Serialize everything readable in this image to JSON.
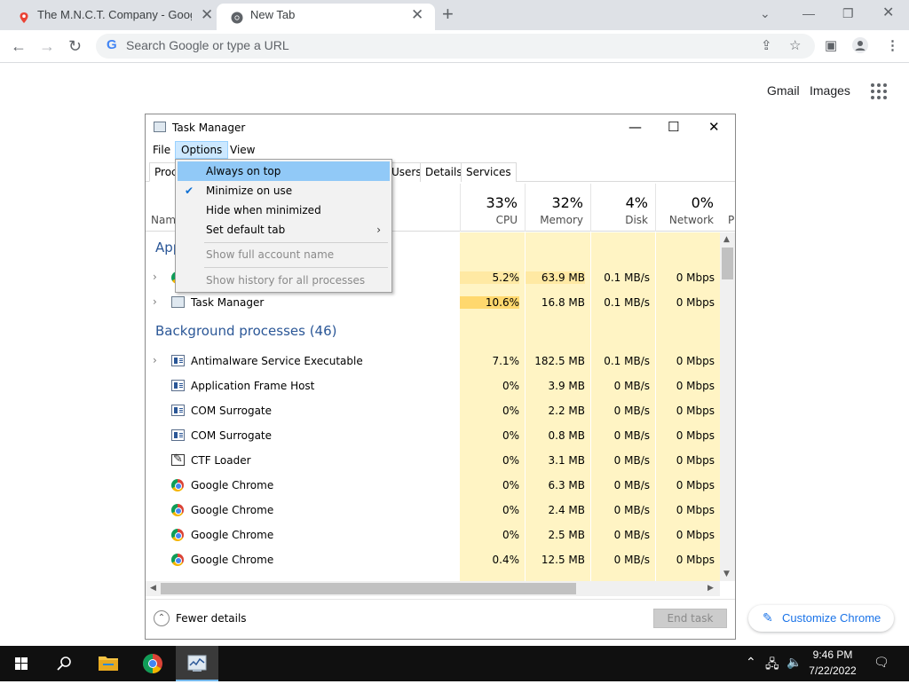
{
  "browser": {
    "tabs": [
      {
        "title": "The M.N.C.T. Company - Google"
      },
      {
        "title": "New Tab"
      }
    ],
    "address_placeholder": "Search Google or type a URL"
  },
  "ntp": {
    "gmail": "Gmail",
    "images": "Images",
    "customize": "Customize Chrome"
  },
  "task_manager": {
    "title": "Task Manager",
    "menu": [
      "File",
      "Options",
      "View"
    ],
    "tabs": [
      "Proc",
      "Users",
      "Details",
      "Services"
    ],
    "columns": [
      {
        "pct": "33%",
        "label": "CPU"
      },
      {
        "pct": "32%",
        "label": "Memory"
      },
      {
        "pct": "4%",
        "label": "Disk"
      },
      {
        "pct": "0%",
        "label": "Network"
      }
    ],
    "name_col": "Nam",
    "power_col": "P",
    "apps_group": "App",
    "bg_group": "Background processes (46)",
    "rows": [
      {
        "name": "",
        "cpu": "5.2%",
        "mem": "63.9 MB",
        "disk": "0.1 MB/s",
        "net": "0 Mbps"
      },
      {
        "name": "Task Manager",
        "cpu": "10.6%",
        "mem": "16.8 MB",
        "disk": "0.1 MB/s",
        "net": "0 Mbps"
      },
      {
        "name": "Antimalware Service Executable",
        "cpu": "7.1%",
        "mem": "182.5 MB",
        "disk": "0.1 MB/s",
        "net": "0 Mbps"
      },
      {
        "name": "Application Frame Host",
        "cpu": "0%",
        "mem": "3.9 MB",
        "disk": "0 MB/s",
        "net": "0 Mbps"
      },
      {
        "name": "COM Surrogate",
        "cpu": "0%",
        "mem": "2.2 MB",
        "disk": "0 MB/s",
        "net": "0 Mbps"
      },
      {
        "name": "COM Surrogate",
        "cpu": "0%",
        "mem": "0.8 MB",
        "disk": "0 MB/s",
        "net": "0 Mbps"
      },
      {
        "name": "CTF Loader",
        "cpu": "0%",
        "mem": "3.1 MB",
        "disk": "0 MB/s",
        "net": "0 Mbps"
      },
      {
        "name": "Google Chrome",
        "cpu": "0%",
        "mem": "6.3 MB",
        "disk": "0 MB/s",
        "net": "0 Mbps"
      },
      {
        "name": "Google Chrome",
        "cpu": "0%",
        "mem": "2.4 MB",
        "disk": "0 MB/s",
        "net": "0 Mbps"
      },
      {
        "name": "Google Chrome",
        "cpu": "0%",
        "mem": "2.5 MB",
        "disk": "0 MB/s",
        "net": "0 Mbps"
      },
      {
        "name": "Google Chrome",
        "cpu": "0.4%",
        "mem": "12.5 MB",
        "disk": "0 MB/s",
        "net": "0 Mbps"
      }
    ],
    "fewer_details": "Fewer details",
    "end_task": "End task"
  },
  "options_menu": {
    "items": [
      {
        "label": "Always on top",
        "checked": false,
        "enabled": true
      },
      {
        "label": "Minimize on use",
        "checked": true,
        "enabled": true
      },
      {
        "label": "Hide when minimized",
        "checked": false,
        "enabled": true
      },
      {
        "label": "Set default tab",
        "submenu": true,
        "enabled": true
      },
      {
        "label": "Show full account name",
        "enabled": false
      },
      {
        "label": "Show history for all processes",
        "enabled": false
      }
    ]
  },
  "taskbar": {
    "time": "9:46 PM",
    "date": "7/22/2022"
  },
  "colors": {
    "heat_light": "#fff4c4",
    "heat_mid": "#ffe9a3",
    "heat_strong": "#ffd86e",
    "menu_highlight": "#91c9f7",
    "group_text": "#2b5797"
  }
}
